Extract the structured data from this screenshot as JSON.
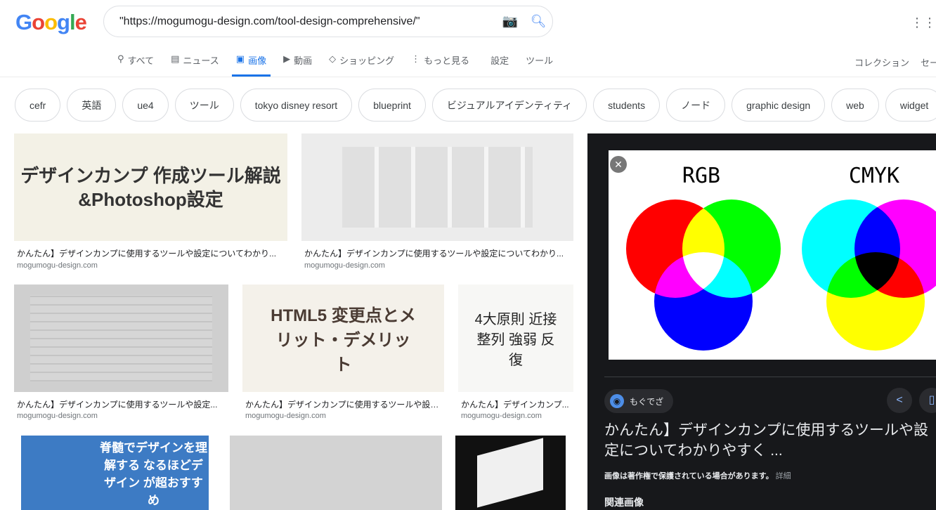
{
  "header": {
    "logo": "Google",
    "query": "\"https://mogumogu-design.com/tool-design-comprehensive/\""
  },
  "tabs": [
    {
      "label": "すべて",
      "icon": "search-icon"
    },
    {
      "label": "ニュース",
      "icon": "news-icon"
    },
    {
      "label": "画像",
      "icon": "image-icon",
      "active": true
    },
    {
      "label": "動画",
      "icon": "play-icon"
    },
    {
      "label": "ショッピング",
      "icon": "tag-icon"
    },
    {
      "label": "もっと見る",
      "icon": "more-vert-icon"
    },
    {
      "label": "設定"
    },
    {
      "label": "ツール"
    }
  ],
  "right_links": [
    "コレクション",
    "セー"
  ],
  "chips": [
    "cefr",
    "英語",
    "ue4",
    "ツール",
    "tokyo disney resort",
    "blueprint",
    "ビジュアルアイデンティティ",
    "students",
    "ノード",
    "graphic design",
    "web",
    "widget"
  ],
  "results": [
    {
      "image_text": "デザインカンプ 作成ツール解説 &Photoshop設定",
      "caption": "かんたん】デザインカンプに使用するツールや設定についてわかり...",
      "source": "mogumogu-design.com"
    },
    {
      "image_text": "",
      "caption": "かんたん】デザインカンプに使用するツールや設定についてわかり...",
      "source": "mogumogu-design.com"
    },
    {
      "image_text": "",
      "caption": "かんたん】デザインカンプに使用するツールや設定...",
      "source": "mogumogu-design.com"
    },
    {
      "image_text": "HTML5 変更点とメリット・デメリット",
      "caption": "かんたん】デザインカンプに使用するツールや設定...",
      "source": "mogumogu-design.com"
    },
    {
      "image_text": "4大原則 近接 整列 強弱 反復",
      "caption": "かんたん】デザインカンプ...",
      "source": "mogumogu-design.com"
    },
    {
      "image_text": "脊髄でデザインを理解する なるほどデザイン が超おすすめ"
    },
    {
      "image_text": ""
    },
    {
      "image_text": ""
    }
  ],
  "panel": {
    "preview_labels": [
      "RGB",
      "CMYK"
    ],
    "site_name": "もぐでざ",
    "title": "かんたん】デザインカンプに使用するツールや設定についてわかりやすく ...",
    "copyright": "画像は著作権で保護されている場合があります。",
    "details_link": "詳細",
    "related": "関連画像"
  }
}
